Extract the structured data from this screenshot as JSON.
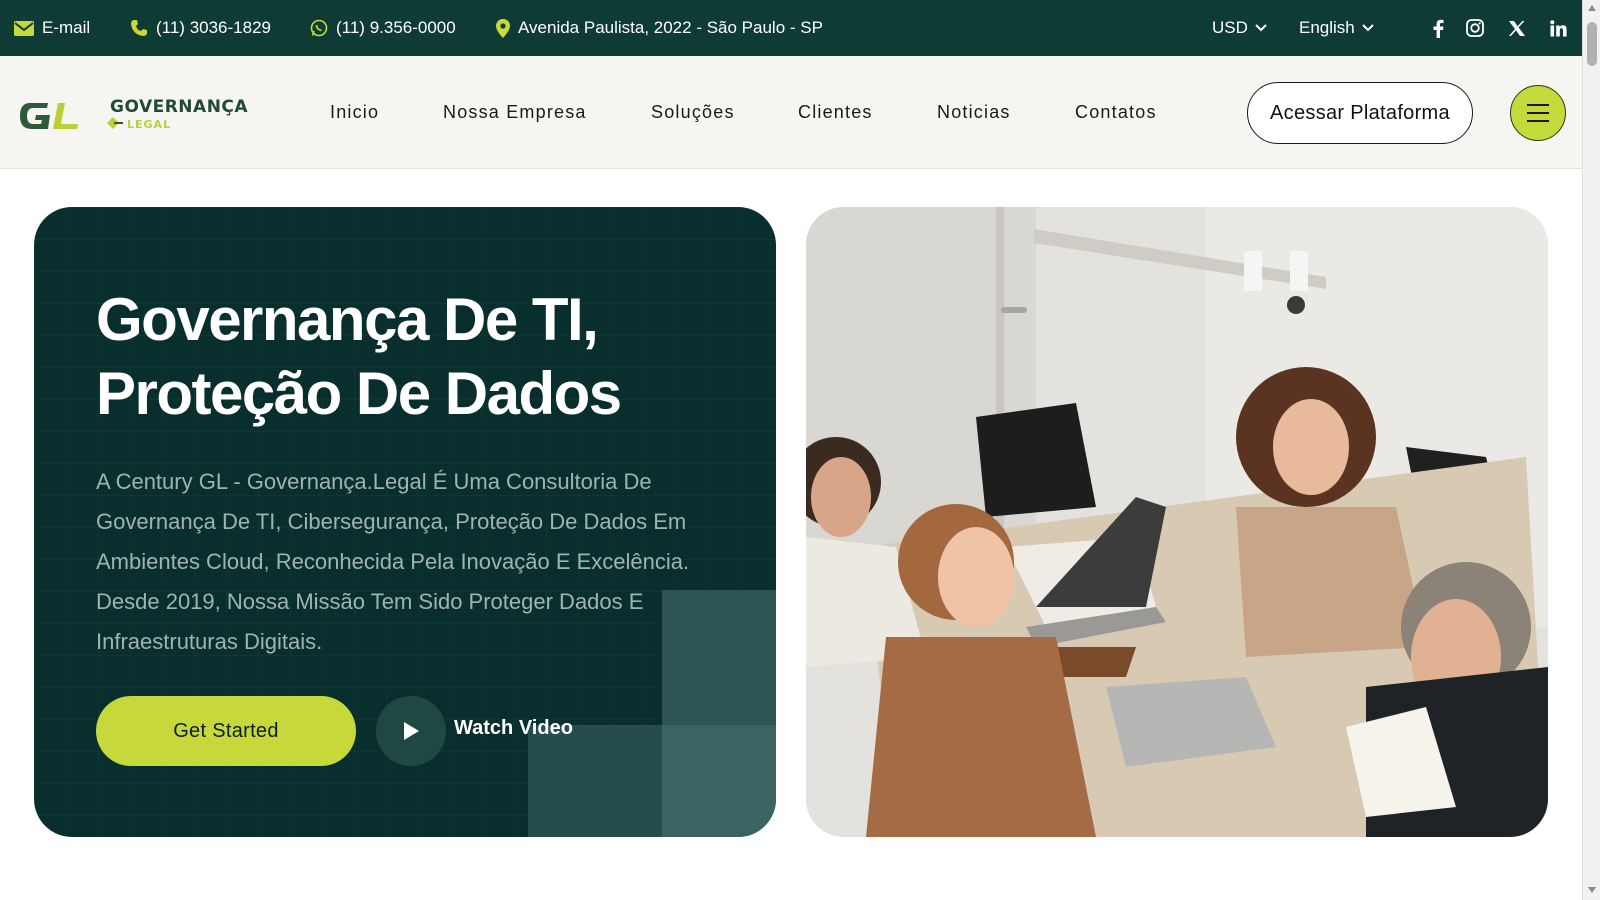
{
  "topbar": {
    "email_label": "E-mail",
    "phone": "(11) 3036-1829",
    "whatsapp": "(11) 9.356-0000",
    "address": "Avenida Paulista, 2022 - São Paulo - SP",
    "currency": "USD",
    "language": "English",
    "socials": [
      "facebook-icon",
      "instagram-icon",
      "x-icon",
      "linkedin-icon"
    ]
  },
  "logo": {
    "word1": "GOVERNANÇA",
    "word2": "LEGAL",
    "mark": "GL"
  },
  "nav": [
    "Inicio",
    "Nossa Empresa",
    "Soluções",
    "Clientes",
    "Noticias",
    "Contatos"
  ],
  "header": {
    "cta_label": "Acessar Plataforma"
  },
  "hero": {
    "title_line1": "Governança De TI,",
    "title_line2": "Proteção De Dados",
    "description": "A Century GL - Governança.Legal É Uma Consultoria De Governança De TI, Cibersegurança, Proteção De Dados Em Ambientes Cloud, Reconhecida Pela Inovação E Excelência. Desde 2019, Nossa Missão Tem Sido Proteger Dados E Infraestruturas Digitais.",
    "primary_button": "Get Started",
    "video_button": "Watch Video"
  },
  "colors": {
    "topbar_bg": "#0e3b34",
    "hero_bg": "#082f2d",
    "accent_lime": "#c6d83a",
    "header_bg": "#f7f5f1"
  }
}
